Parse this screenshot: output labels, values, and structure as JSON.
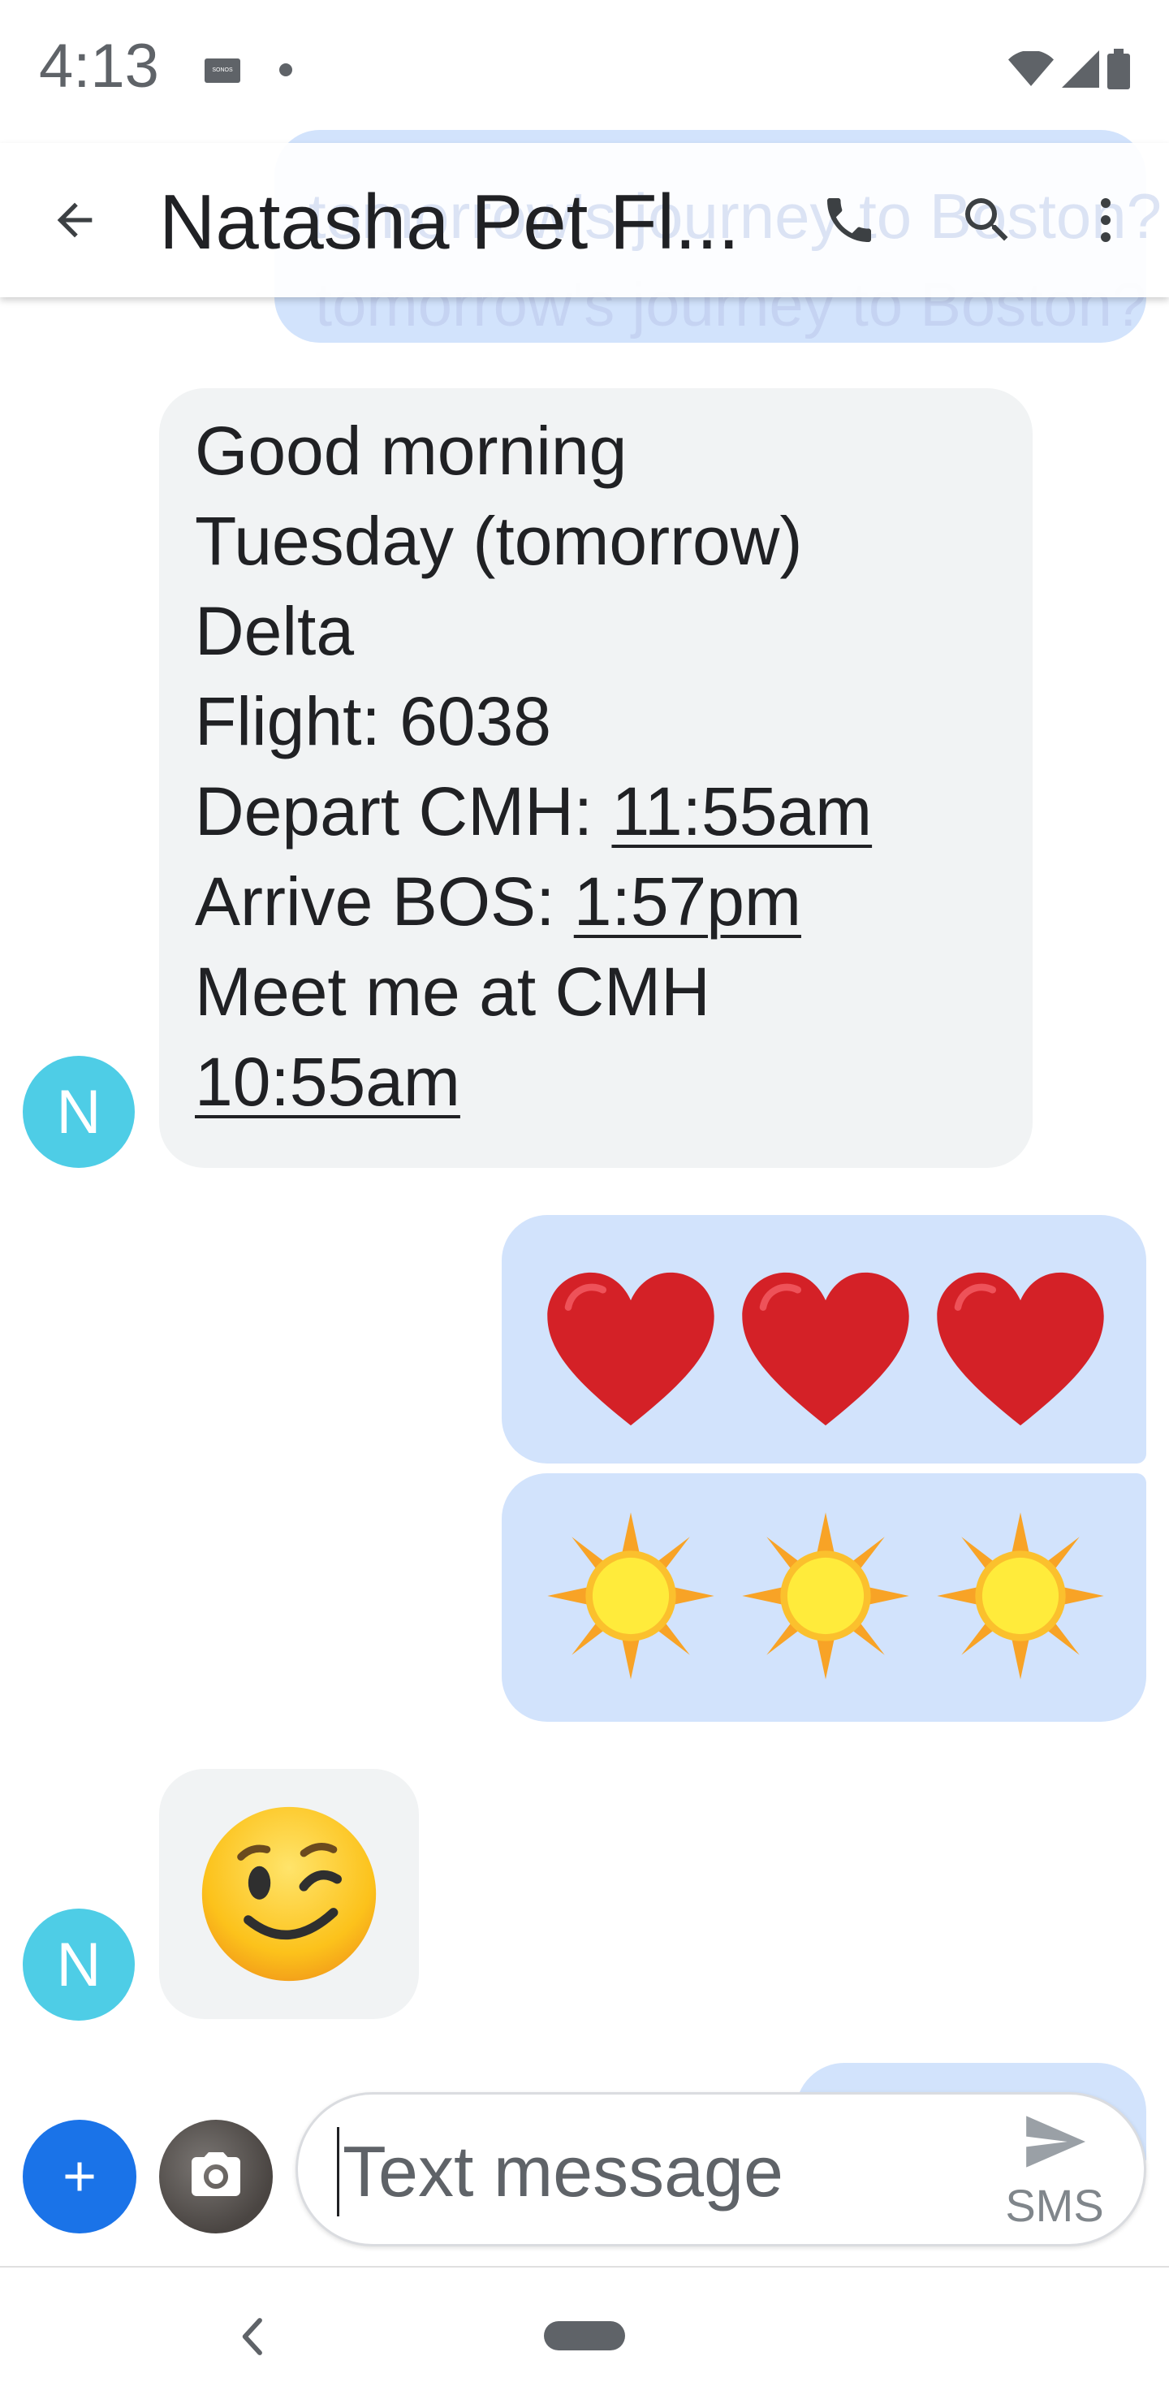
{
  "status_bar": {
    "time": "4:13",
    "sonos_badge": "SONOS"
  },
  "header": {
    "title": "Natasha Pet Fl...",
    "ghost_text": "tomorrow's journey to Boston?"
  },
  "previous_message_peek": "tomorrow's journey to Boston?",
  "messages": [
    {
      "direction": "incoming",
      "avatar_letter": "N",
      "lines": [
        {
          "text": "Good morning"
        },
        {
          "text": "Tuesday (tomorrow)"
        },
        {
          "text": "Delta"
        },
        {
          "text": "Flight: 6038"
        },
        {
          "prefix": "Depart CMH: ",
          "link": "11:55am"
        },
        {
          "prefix": "Arrive BOS: ",
          "link": "1:57pm"
        },
        {
          "text": "Meet me at CMH"
        },
        {
          "link": "10:55am"
        }
      ]
    },
    {
      "direction": "outgoing",
      "emojis": [
        "red-heart",
        "red-heart",
        "red-heart"
      ]
    },
    {
      "direction": "outgoing",
      "emojis": [
        "sun",
        "sun",
        "sun"
      ]
    },
    {
      "direction": "incoming",
      "avatar_letter": "N",
      "emojis": [
        "winking-face"
      ]
    }
  ],
  "composer": {
    "placeholder": "Text message",
    "send_label": "SMS"
  },
  "colors": {
    "incoming_bubble": "#f1f3f4",
    "outgoing_bubble": "#d2e3fc",
    "avatar": "#4ecde6",
    "add_button": "#1a73e8"
  },
  "icons": [
    "back-arrow-icon",
    "phone-icon",
    "search-icon",
    "more-vert-icon",
    "add-icon",
    "camera-icon",
    "send-icon",
    "wifi-icon",
    "signal-icon",
    "battery-icon"
  ]
}
